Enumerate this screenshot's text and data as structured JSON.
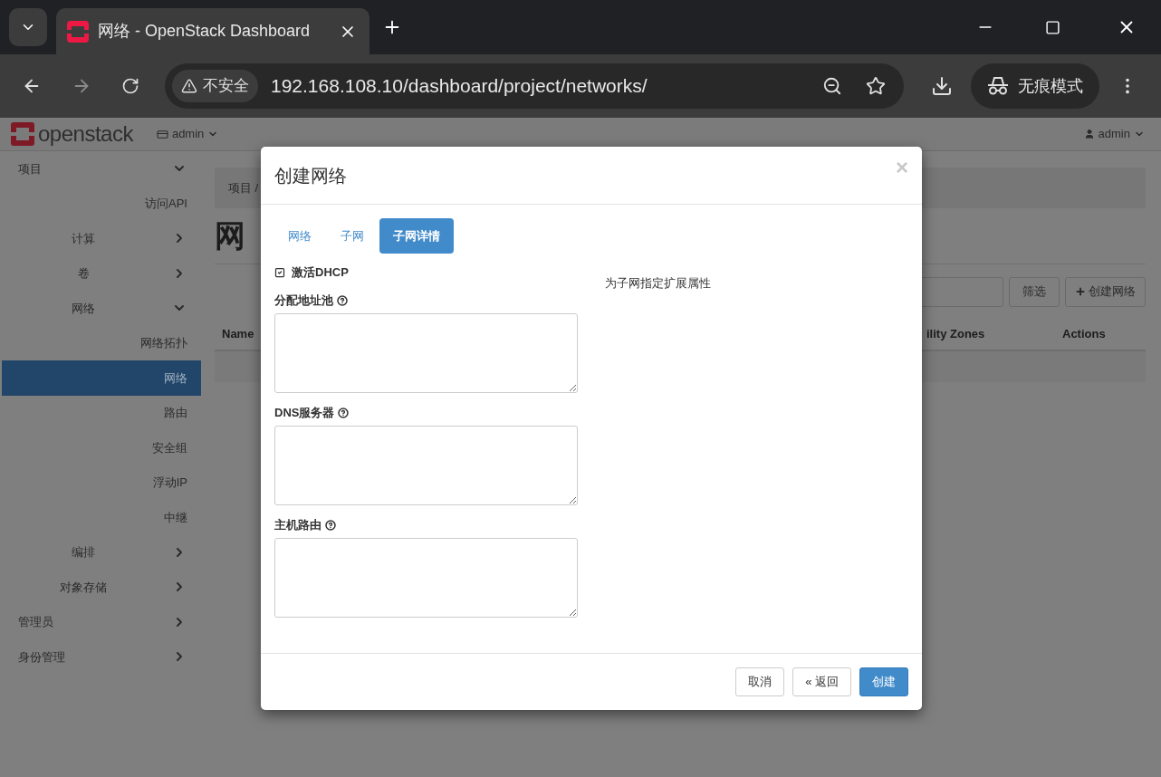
{
  "browser": {
    "tab": {
      "title": "网络 - OpenStack Dashboard"
    },
    "address": {
      "security": "不安全",
      "url": "192.168.108.10/dashboard/project/networks/"
    },
    "incognito": "无痕模式"
  },
  "header": {
    "logo": "openstack",
    "project": "admin",
    "user": "admin"
  },
  "sidebar": {
    "items": [
      {
        "label": "项目",
        "kind": "group",
        "expanded": true,
        "children": [
          {
            "label": "访问API",
            "kind": "link",
            "selected": false
          },
          {
            "label": "计算",
            "kind": "group",
            "expanded": false
          },
          {
            "label": "卷",
            "kind": "group",
            "expanded": false
          },
          {
            "label": "网络",
            "kind": "group",
            "expanded": true,
            "children": [
              {
                "label": "网络拓扑",
                "kind": "link",
                "selected": false
              },
              {
                "label": "网络",
                "kind": "link",
                "selected": true
              },
              {
                "label": "路由",
                "kind": "link",
                "selected": false
              },
              {
                "label": "安全组",
                "kind": "link",
                "selected": false
              },
              {
                "label": "浮动IP",
                "kind": "link",
                "selected": false
              },
              {
                "label": "中继",
                "kind": "link",
                "selected": false
              }
            ]
          },
          {
            "label": "编排",
            "kind": "group",
            "expanded": false
          },
          {
            "label": "对象存储",
            "kind": "group",
            "expanded": false
          }
        ]
      },
      {
        "label": "管理员",
        "kind": "group",
        "expanded": false
      },
      {
        "label": "身份管理",
        "kind": "group",
        "expanded": false
      }
    ]
  },
  "content": {
    "breadcrumb": "项目 /",
    "heading": "网",
    "filter_button": "筛选",
    "create_button": "创建网络",
    "table": {
      "columns": [
        "Name",
        "ility Zones",
        "Actions"
      ]
    }
  },
  "modal": {
    "title": "创建网络",
    "close": "×",
    "tabs": [
      {
        "label": "网络",
        "selected": false
      },
      {
        "label": "子网",
        "selected": false
      },
      {
        "label": "子网详情",
        "selected": true
      }
    ],
    "dhcp": {
      "label": "激活DHCP",
      "checked": true
    },
    "fields": [
      {
        "label": "分配地址池"
      },
      {
        "label": "DNS服务器"
      },
      {
        "label": "主机路由"
      }
    ],
    "help_text": "为子网指定扩展属性",
    "buttons": [
      {
        "label": "取消",
        "kind": "default"
      },
      {
        "label": "« 返回",
        "kind": "default"
      },
      {
        "label": "创建",
        "kind": "primary"
      }
    ]
  }
}
